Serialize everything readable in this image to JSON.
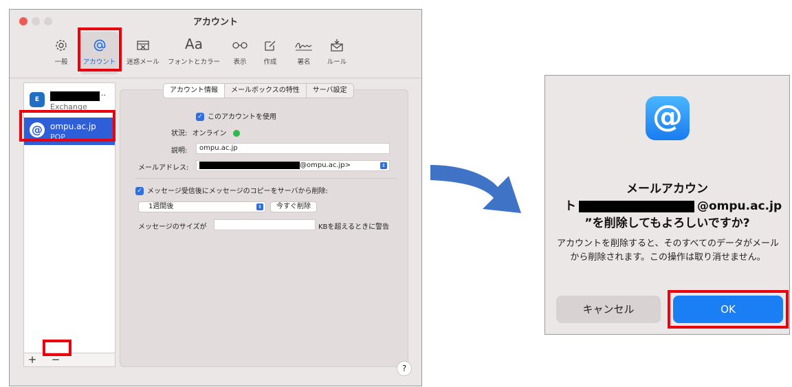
{
  "window": {
    "title": "アカウント",
    "toolbar": [
      {
        "label": "一般",
        "icon": "gear-icon"
      },
      {
        "label": "アカウント",
        "icon": "at-icon"
      },
      {
        "label": "迷惑メール",
        "icon": "junk-tray-icon"
      },
      {
        "label": "フォントとカラー",
        "icon": "fonts-icon",
        "glyph": "Aa"
      },
      {
        "label": "表示",
        "icon": "glasses-icon"
      },
      {
        "label": "作成",
        "icon": "compose-icon"
      },
      {
        "label": "署名",
        "icon": "signature-icon"
      },
      {
        "label": "ルール",
        "icon": "rules-icon"
      }
    ],
    "accounts": [
      {
        "type": "Exchange",
        "icon_text": "E"
      },
      {
        "name": "ompu.ac.jp",
        "type": "POP"
      }
    ],
    "list_buttons": {
      "add": "+",
      "remove": "−"
    },
    "tabs": [
      "アカウント情報",
      "メールボックスの特性",
      "サーバ設定"
    ],
    "use_account_label": "このアカウントを使用",
    "status_label": "状況:",
    "status_value": "オンライン",
    "description_label": "説明:",
    "description_value": "ompu.ac.jp",
    "email_label": "メールアドレス:",
    "email_suffix": "@ompu.ac.jp>",
    "delete_copy_label": "メッセージ受信後にメッセージのコピーをサーバから削除:",
    "delete_after_value": "1週間後",
    "delete_now_button": "今すぐ削除",
    "size_label": "メッセージのサイズが",
    "size_suffix": "KBを超えるときに警告",
    "help": "?"
  },
  "dialog": {
    "icon_text": "@",
    "title_line1": "メールアカウン",
    "title_line2_prefix": "ト",
    "title_line2_suffix": "@ompu.ac.jp",
    "title_line3": "”を削除してもよろしいですか?",
    "body": "アカウントを削除すると、そのすべてのデータがメールから削除されます。この操作は取り消せません。",
    "cancel_label": "キャンセル",
    "ok_label": "OK"
  },
  "colors": {
    "accent": "#1a7ef5",
    "highlight": "#e8000f",
    "online": "#2fb94a",
    "arrow": "#3f73c6"
  }
}
